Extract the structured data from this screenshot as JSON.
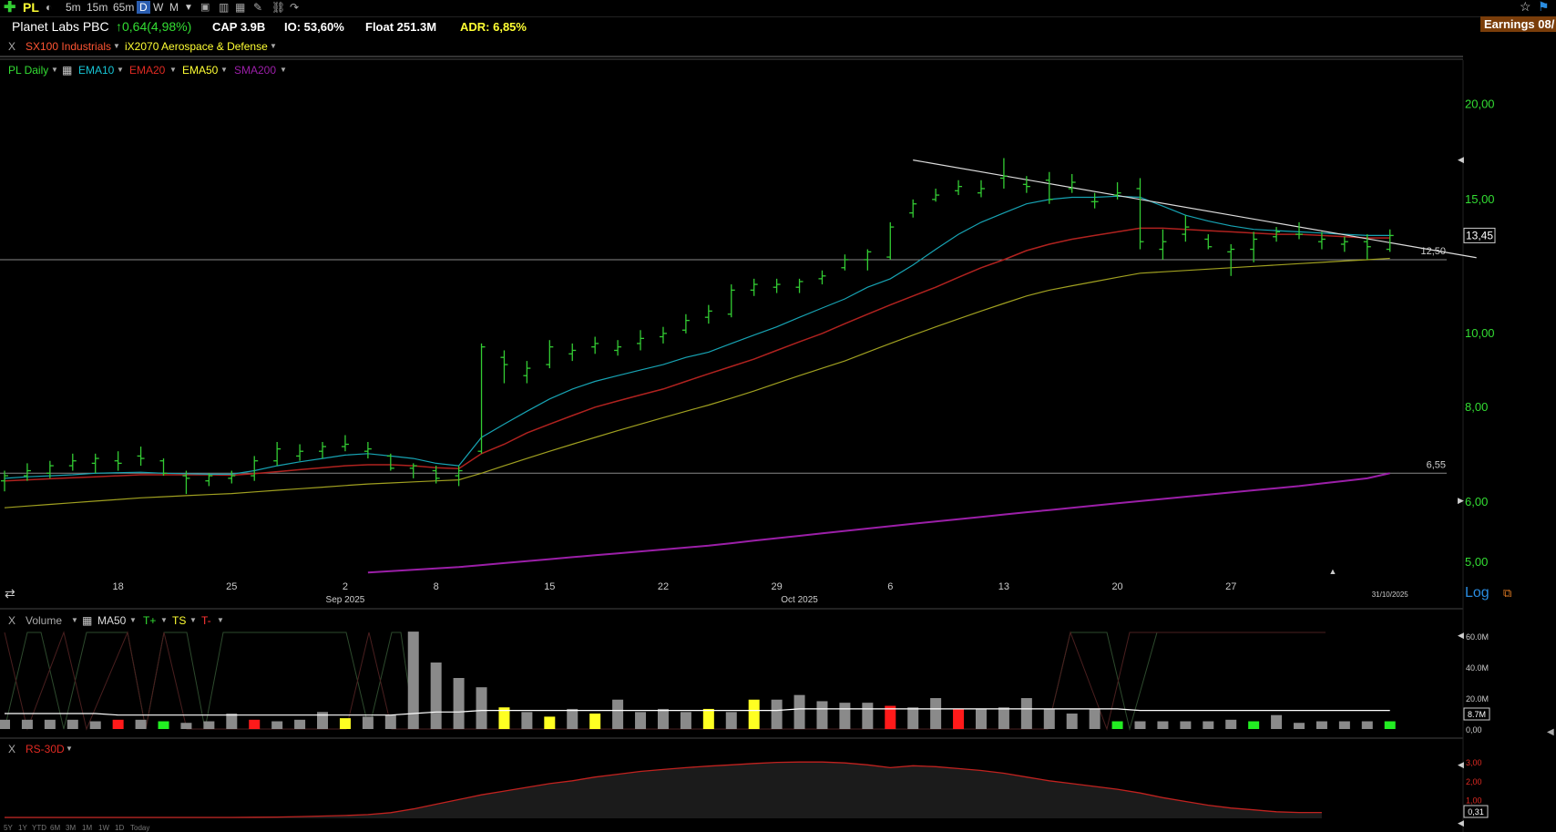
{
  "toolbar": {
    "symbol": "PL",
    "timeframes": [
      "5m",
      "15m",
      "65m",
      "D",
      "W",
      "M"
    ],
    "active_timeframe": "D",
    "earnings": "Earnings 08/"
  },
  "info": {
    "name": "Planet Labs PBC",
    "change": "↑0,64(4,98%)",
    "cap": "CAP 3.9B",
    "io": "IO: 53,60%",
    "float": "Float 251.3M",
    "adr": "ADR: 6,85%"
  },
  "industry": {
    "close_x": "X",
    "sector": "SX100 Industrials",
    "group": "iX2070 Aerospace & Defense"
  },
  "price_legend": {
    "series": "PL Daily",
    "ema10": "EMA10",
    "ema20": "EMA20",
    "ema50": "EMA50",
    "sma200": "SMA200"
  },
  "volume_legend": {
    "close_x": "X",
    "volume": "Volume",
    "ma50": "MA50",
    "tplus": "T+",
    "ts": "TS",
    "tminus": "T-"
  },
  "rs_legend": {
    "close_x": "X",
    "rs": "RS-30D"
  },
  "log_label": "Log",
  "range_buttons": [
    "5Y",
    "1Y",
    "YTD",
    "6M",
    "3M",
    "1M",
    "1W",
    "1D",
    "Today"
  ],
  "colors": {
    "up": "#33cc33",
    "ema10": "#17a3b3",
    "ema20": "#b0221f",
    "ema50": "#a0a020",
    "sma200": "#9b1fa8",
    "volume_gray": "#8a8a8a",
    "volume_yellow": "#ffff22",
    "volume_red": "#ff1a1a",
    "volume_green": "#22ee22",
    "rs": "#c0221f",
    "trendline": "#dddddd"
  },
  "chart_data": [
    {
      "type": "ohlc",
      "title": "PL Daily",
      "scale": "log",
      "ylim": [
        4.8,
        22
      ],
      "y_ticks": [
        "20,00",
        "15,00",
        "10,00",
        "8,00",
        "6,00",
        "5,00"
      ],
      "x_ticks": [
        "18",
        "25",
        "2",
        "8",
        "15",
        "22",
        "29",
        "6",
        "13",
        "20",
        "27"
      ],
      "x_month_labels": [
        "Sep 2025",
        "Oct 2025"
      ],
      "last_date_label": "31/10/2025",
      "last_price_label": "13,45",
      "horizontal_levels": [
        {
          "value": 12.5,
          "label": "12,50"
        },
        {
          "value": 6.55,
          "label": "6,55"
        }
      ],
      "bars": [
        {
          "o": 6.4,
          "h": 6.6,
          "l": 6.2,
          "c": 6.5
        },
        {
          "o": 6.5,
          "h": 6.75,
          "l": 6.4,
          "c": 6.6
        },
        {
          "o": 6.55,
          "h": 6.8,
          "l": 6.45,
          "c": 6.7
        },
        {
          "o": 6.7,
          "h": 6.95,
          "l": 6.6,
          "c": 6.8
        },
        {
          "o": 6.75,
          "h": 6.95,
          "l": 6.55,
          "c": 6.85
        },
        {
          "o": 6.8,
          "h": 7.0,
          "l": 6.6,
          "c": 6.75
        },
        {
          "o": 6.9,
          "h": 7.1,
          "l": 6.7,
          "c": 6.85
        },
        {
          "o": 6.8,
          "h": 6.85,
          "l": 6.5,
          "c": 6.55
        },
        {
          "o": 6.5,
          "h": 6.6,
          "l": 6.15,
          "c": 6.45
        },
        {
          "o": 6.4,
          "h": 6.55,
          "l": 6.3,
          "c": 6.5
        },
        {
          "o": 6.45,
          "h": 6.6,
          "l": 6.35,
          "c": 6.5
        },
        {
          "o": 6.5,
          "h": 6.9,
          "l": 6.4,
          "c": 6.8
        },
        {
          "o": 6.8,
          "h": 7.2,
          "l": 6.7,
          "c": 7.05
        },
        {
          "o": 6.9,
          "h": 7.15,
          "l": 6.8,
          "c": 7.0
        },
        {
          "o": 7.0,
          "h": 7.2,
          "l": 6.85,
          "c": 7.1
        },
        {
          "o": 7.1,
          "h": 7.35,
          "l": 7.0,
          "c": 7.15
        },
        {
          "o": 7.0,
          "h": 7.2,
          "l": 6.85,
          "c": 7.05
        },
        {
          "o": 6.9,
          "h": 6.95,
          "l": 6.6,
          "c": 6.65
        },
        {
          "o": 6.65,
          "h": 6.75,
          "l": 6.45,
          "c": 6.7
        },
        {
          "o": 6.6,
          "h": 6.7,
          "l": 6.35,
          "c": 6.45
        },
        {
          "o": 6.5,
          "h": 6.7,
          "l": 6.3,
          "c": 6.6
        },
        {
          "o": 7.0,
          "h": 9.7,
          "l": 6.95,
          "c": 9.6
        },
        {
          "o": 9.3,
          "h": 9.5,
          "l": 8.6,
          "c": 9.1
        },
        {
          "o": 8.8,
          "h": 9.2,
          "l": 8.6,
          "c": 9.0
        },
        {
          "o": 9.1,
          "h": 9.8,
          "l": 9.0,
          "c": 9.6
        },
        {
          "o": 9.4,
          "h": 9.7,
          "l": 9.2,
          "c": 9.5
        },
        {
          "o": 9.6,
          "h": 9.9,
          "l": 9.4,
          "c": 9.7
        },
        {
          "o": 9.5,
          "h": 9.8,
          "l": 9.35,
          "c": 9.6
        },
        {
          "o": 9.7,
          "h": 10.1,
          "l": 9.5,
          "c": 9.85
        },
        {
          "o": 9.9,
          "h": 10.2,
          "l": 9.7,
          "c": 10.0
        },
        {
          "o": 10.1,
          "h": 10.6,
          "l": 10.0,
          "c": 10.4
        },
        {
          "o": 10.5,
          "h": 10.9,
          "l": 10.3,
          "c": 10.7
        },
        {
          "o": 10.6,
          "h": 11.6,
          "l": 10.5,
          "c": 11.4
        },
        {
          "o": 11.4,
          "h": 11.8,
          "l": 11.2,
          "c": 11.6
        },
        {
          "o": 11.5,
          "h": 11.8,
          "l": 11.3,
          "c": 11.6
        },
        {
          "o": 11.5,
          "h": 11.8,
          "l": 11.3,
          "c": 11.7
        },
        {
          "o": 11.8,
          "h": 12.1,
          "l": 11.6,
          "c": 11.9
        },
        {
          "o": 12.2,
          "h": 12.7,
          "l": 12.1,
          "c": 12.5
        },
        {
          "o": 12.5,
          "h": 12.9,
          "l": 12.1,
          "c": 12.8
        },
        {
          "o": 12.6,
          "h": 14.0,
          "l": 12.5,
          "c": 13.8
        },
        {
          "o": 14.4,
          "h": 15.0,
          "l": 14.2,
          "c": 14.8
        },
        {
          "o": 15.0,
          "h": 15.5,
          "l": 14.9,
          "c": 15.2
        },
        {
          "o": 15.4,
          "h": 15.9,
          "l": 15.2,
          "c": 15.6
        },
        {
          "o": 15.3,
          "h": 15.9,
          "l": 15.1,
          "c": 15.5
        },
        {
          "o": 16.0,
          "h": 17.0,
          "l": 15.5,
          "c": 16.1
        },
        {
          "o": 15.7,
          "h": 16.1,
          "l": 15.3,
          "c": 15.6
        },
        {
          "o": 15.9,
          "h": 16.3,
          "l": 14.8,
          "c": 15.0
        },
        {
          "o": 15.5,
          "h": 16.2,
          "l": 15.3,
          "c": 15.8
        },
        {
          "o": 14.9,
          "h": 15.3,
          "l": 14.6,
          "c": 14.9
        },
        {
          "o": 15.2,
          "h": 15.8,
          "l": 15.0,
          "c": 15.3
        },
        {
          "o": 15.5,
          "h": 16.0,
          "l": 12.9,
          "c": 13.2
        },
        {
          "o": 12.9,
          "h": 13.7,
          "l": 12.5,
          "c": 13.2
        },
        {
          "o": 13.5,
          "h": 14.3,
          "l": 13.2,
          "c": 13.8
        },
        {
          "o": 13.3,
          "h": 13.5,
          "l": 12.9,
          "c": 13.0
        },
        {
          "o": 12.8,
          "h": 13.1,
          "l": 11.9,
          "c": 12.9
        },
        {
          "o": 12.9,
          "h": 13.6,
          "l": 12.4,
          "c": 13.3
        },
        {
          "o": 13.4,
          "h": 13.8,
          "l": 13.2,
          "c": 13.6
        },
        {
          "o": 13.5,
          "h": 14.0,
          "l": 13.3,
          "c": 13.5
        },
        {
          "o": 13.2,
          "h": 13.6,
          "l": 12.9,
          "c": 13.3
        },
        {
          "o": 13.1,
          "h": 13.4,
          "l": 12.8,
          "c": 13.2
        },
        {
          "o": 13.2,
          "h": 13.5,
          "l": 12.5,
          "c": 13.0
        },
        {
          "o": 12.9,
          "h": 13.7,
          "l": 12.8,
          "c": 13.45
        }
      ],
      "ema10": [
        6.45,
        6.48,
        6.5,
        6.52,
        6.55,
        6.56,
        6.57,
        6.55,
        6.54,
        6.53,
        6.53,
        6.6,
        6.7,
        6.78,
        6.85,
        6.92,
        6.95,
        6.9,
        6.85,
        6.75,
        6.7,
        7.3,
        7.6,
        7.9,
        8.2,
        8.45,
        8.65,
        8.8,
        8.95,
        9.1,
        9.3,
        9.45,
        9.7,
        9.95,
        10.2,
        10.5,
        10.8,
        11.1,
        11.5,
        11.8,
        12.3,
        12.9,
        13.5,
        14.0,
        14.4,
        14.8,
        15.0,
        15.1,
        15.1,
        15.15,
        15.1,
        14.7,
        14.3,
        14.05,
        13.85,
        13.7,
        13.65,
        13.6,
        13.55,
        13.5,
        13.45,
        13.45
      ],
      "ema20": [
        6.4,
        6.42,
        6.44,
        6.46,
        6.48,
        6.5,
        6.52,
        6.52,
        6.52,
        6.52,
        6.51,
        6.54,
        6.58,
        6.62,
        6.66,
        6.7,
        6.72,
        6.72,
        6.7,
        6.66,
        6.64,
        6.95,
        7.15,
        7.4,
        7.6,
        7.8,
        8.0,
        8.15,
        8.3,
        8.45,
        8.65,
        8.85,
        9.05,
        9.25,
        9.5,
        9.75,
        10.0,
        10.3,
        10.6,
        10.9,
        11.2,
        11.5,
        11.85,
        12.2,
        12.5,
        12.85,
        13.1,
        13.3,
        13.45,
        13.6,
        13.75,
        13.75,
        13.7,
        13.65,
        13.6,
        13.55,
        13.5,
        13.5,
        13.45,
        13.4,
        13.35,
        13.35
      ],
      "ema50": [
        5.9,
        5.93,
        5.96,
        5.99,
        6.02,
        6.05,
        6.08,
        6.1,
        6.12,
        6.14,
        6.16,
        6.19,
        6.22,
        6.25,
        6.28,
        6.31,
        6.34,
        6.36,
        6.38,
        6.4,
        6.42,
        6.55,
        6.7,
        6.85,
        7.0,
        7.15,
        7.3,
        7.45,
        7.6,
        7.75,
        7.9,
        8.05,
        8.22,
        8.4,
        8.6,
        8.8,
        9.0,
        9.2,
        9.45,
        9.7,
        9.95,
        10.2,
        10.45,
        10.7,
        10.95,
        11.2,
        11.4,
        11.55,
        11.7,
        11.85,
        12.0,
        12.05,
        12.1,
        12.15,
        12.2,
        12.25,
        12.3,
        12.35,
        12.4,
        12.45,
        12.5,
        12.55
      ],
      "sma200": [
        null,
        null,
        null,
        null,
        null,
        null,
        null,
        null,
        null,
        null,
        null,
        null,
        null,
        null,
        null,
        null,
        4.85,
        4.87,
        4.89,
        4.91,
        4.93,
        4.96,
        4.99,
        5.02,
        5.05,
        5.08,
        5.11,
        5.14,
        5.17,
        5.2,
        5.23,
        5.26,
        5.3,
        5.34,
        5.38,
        5.42,
        5.46,
        5.5,
        5.54,
        5.58,
        5.62,
        5.66,
        5.7,
        5.74,
        5.78,
        5.82,
        5.86,
        5.9,
        5.94,
        5.98,
        6.02,
        6.06,
        6.1,
        6.14,
        6.18,
        6.22,
        6.26,
        6.3,
        6.35,
        6.4,
        6.45,
        6.55
      ],
      "trendline": [
        {
          "bar": 40,
          "value": 16.9
        },
        {
          "bar": 62,
          "value": 13.0
        }
      ]
    },
    {
      "type": "bar",
      "title": "Volume",
      "y_ticks": [
        "60.0M",
        "40.0M",
        "20.0M",
        "0,00"
      ],
      "ylim": [
        0,
        66
      ],
      "last_value_label": "8.7M",
      "values": [
        6,
        6,
        6,
        6,
        5,
        6,
        6,
        5,
        4,
        5,
        10,
        6,
        5,
        6,
        11,
        7,
        8,
        9,
        63,
        43,
        33,
        27,
        14,
        11,
        8,
        13,
        10,
        19,
        11,
        13,
        11,
        13,
        11,
        19,
        19,
        22,
        18,
        17,
        17,
        15,
        14,
        20,
        13,
        13,
        14,
        20,
        13,
        10,
        13,
        5,
        5,
        5,
        5,
        5,
        6,
        5,
        9,
        4,
        5,
        5,
        5,
        5
      ],
      "colors": [
        "gray",
        "gray",
        "gray",
        "gray",
        "gray",
        "red",
        "gray",
        "green",
        "gray",
        "gray",
        "gray",
        "red",
        "gray",
        "gray",
        "gray",
        "yellow",
        "gray",
        "gray",
        "gray",
        "gray",
        "gray",
        "gray",
        "yellow",
        "gray",
        "yellow",
        "gray",
        "yellow",
        "gray",
        "gray",
        "gray",
        "gray",
        "yellow",
        "gray",
        "yellow",
        "gray",
        "gray",
        "gray",
        "gray",
        "gray",
        "red",
        "gray",
        "gray",
        "red",
        "gray",
        "gray",
        "gray",
        "gray",
        "gray",
        "gray",
        "green",
        "gray",
        "gray",
        "gray",
        "gray",
        "gray",
        "green",
        "gray",
        "gray",
        "gray",
        "gray",
        "gray",
        "green"
      ],
      "ma50": [
        10,
        10,
        10,
        10,
        10,
        9,
        9,
        9,
        9,
        9,
        9,
        9,
        9,
        9,
        9,
        9,
        9,
        9,
        10,
        11,
        11,
        12,
        12,
        12,
        12,
        12,
        12,
        12,
        12,
        12,
        12,
        12,
        12,
        12,
        12,
        13,
        13,
        13,
        13,
        13,
        13,
        13,
        13,
        13,
        13,
        13,
        13,
        13,
        13,
        13,
        12,
        12,
        12,
        12,
        12,
        12,
        12,
        12,
        12,
        12,
        12,
        12
      ]
    },
    {
      "type": "area",
      "title": "RS-30D",
      "y_ticks": [
        "3,00",
        "2,00",
        "1,00"
      ],
      "ylim": [
        0,
        3.3
      ],
      "last_value_label": "0,31",
      "values": [
        0.05,
        0.05,
        0.05,
        0.05,
        0.05,
        0.05,
        0.05,
        0.05,
        0.05,
        0.05,
        0.05,
        0.06,
        0.07,
        0.09,
        0.12,
        0.15,
        0.2,
        0.3,
        0.5,
        0.75,
        1.0,
        1.25,
        1.45,
        1.65,
        1.85,
        2.0,
        2.2,
        2.35,
        2.5,
        2.6,
        2.7,
        2.78,
        2.85,
        2.92,
        2.98,
        3.0,
        3.0,
        2.95,
        2.85,
        2.7,
        2.8,
        2.75,
        2.65,
        2.55,
        2.4,
        2.2,
        2.0,
        1.85,
        1.7,
        1.55,
        1.35,
        1.1,
        0.9,
        0.7,
        0.55,
        0.45,
        0.35,
        0.31,
        0.31
      ]
    }
  ]
}
